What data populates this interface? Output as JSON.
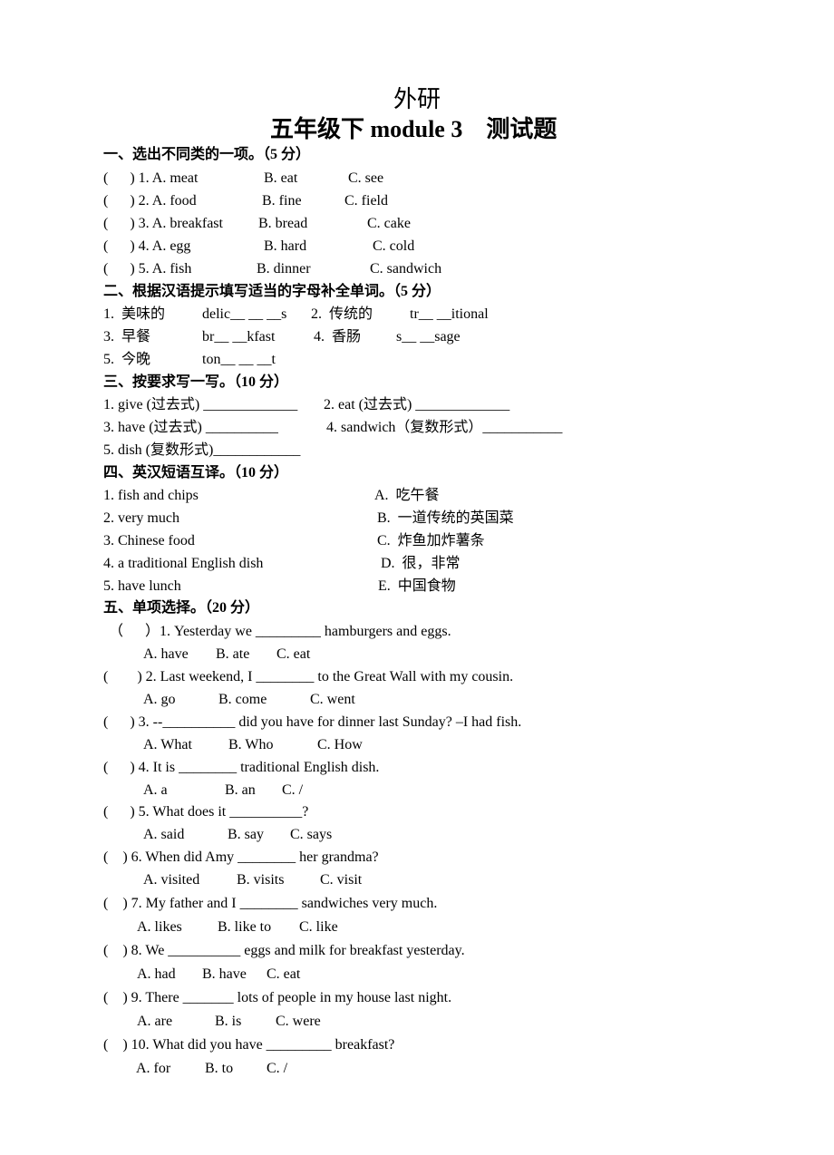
{
  "title": "外研",
  "subtitle": "五年级下 module 3    测试题",
  "sections": [
    {
      "heading": "一、选出不同类的一项。（5 分）",
      "items": [
        {
          "q": "(      ) 1. A. meat",
          "b": "B. eat",
          "c": "C. see"
        },
        {
          "q": "(      ) 2. A. food",
          "b": "B. fine",
          "c": "C. field"
        },
        {
          "q": "(      ) 3. A. breakfast",
          "b": "B. bread",
          "c": "C. cake"
        },
        {
          "q": "(      ) 4. A. egg",
          "b": "B. hard",
          "c": "C. cold"
        },
        {
          "q": "(      ) 5. A. fish",
          "b": "B. dinner",
          "c": "C. sandwich"
        }
      ]
    },
    {
      "heading": "二、根据汉语提示填写适当的字母补全单词。（5 分）",
      "items": [
        {
          "n1": "1.  美味的",
          "w1": "delic__ __ __s",
          "n2": "2.  传统的",
          "w2": "tr__ __itional"
        },
        {
          "n1": "3.  早餐",
          "w1": "br__ __kfast",
          "n2": "4.  香肠",
          "w2": "s__ __sage"
        },
        {
          "n1": "5.  今晚",
          "w1": "ton__ __ __t"
        }
      ]
    },
    {
      "heading": "三、按要求写一写。（10 分）",
      "items": [
        {
          "a": "1. give (过去式) _____________",
          "b": "2. eat (过去式) _____________"
        },
        {
          "a": "3. have (过去式) __________",
          "b": "4. sandwich（复数形式）___________"
        },
        {
          "a": "5. dish (复数形式)____________"
        }
      ]
    },
    {
      "heading": "四、英汉短语互译。（10 分）",
      "items": [
        {
          "en": "1. fish and chips",
          "zh": "A.  吃午餐"
        },
        {
          "en": "2. very much",
          "zh": "B.  一道传统的英国菜"
        },
        {
          "en": "3. Chinese food",
          "zh": "C.  炸鱼加炸薯条"
        },
        {
          "en": "4. a traditional English dish",
          "zh": "D.  很，非常"
        },
        {
          "en": "5. have lunch",
          "zh": "E.  中国食物"
        }
      ]
    },
    {
      "heading": "五、单项选择。（20 分）",
      "items": [
        {
          "q": "（      ）1. Yesterday we _________ hamburgers and eggs.",
          "a": "A. have",
          "b": "B. ate",
          "c": "C. eat"
        },
        {
          "q": "(        ) 2. Last weekend, I ________ to the Great Wall with my cousin.",
          "a": "A. go",
          "b": "B. come",
          "c": "C. went"
        },
        {
          "q": "(      ) 3. --__________ did you have for dinner last Sunday? –I had fish.",
          "a": "A. What",
          "b": "B. Who",
          "c": "C. How"
        },
        {
          "q": "(      ) 4. It is ________ traditional English dish.",
          "a": "A. a",
          "b": "B. an",
          "c": "C. /"
        },
        {
          "q": "(      ) 5. What does it __________?",
          "a": "A. said",
          "b": "B. say",
          "c": "C. says"
        },
        {
          "q": "(    ) 6. When did Amy ________ her grandma?",
          "a": "A. visited",
          "b": "B. visits",
          "c": "C. visit"
        },
        {
          "q": "(    ) 7. My father and I ________ sandwiches very much.",
          "a": "A. likes",
          "b": "B. like to",
          "c": "C. like"
        },
        {
          "q": "(    ) 8. We __________ eggs and milk for breakfast yesterday.",
          "a": "A. had",
          "b": "B. have",
          "c": "C. eat"
        },
        {
          "q": "(    ) 9. There _______ lots of people in my house last night.",
          "a": "A. are",
          "b": "B. is",
          "c": "C. were"
        },
        {
          "q": "(    ) 10. What did you have _________ breakfast?",
          "a": "A. for",
          "b": "B. to",
          "c": "C. /"
        }
      ]
    }
  ]
}
